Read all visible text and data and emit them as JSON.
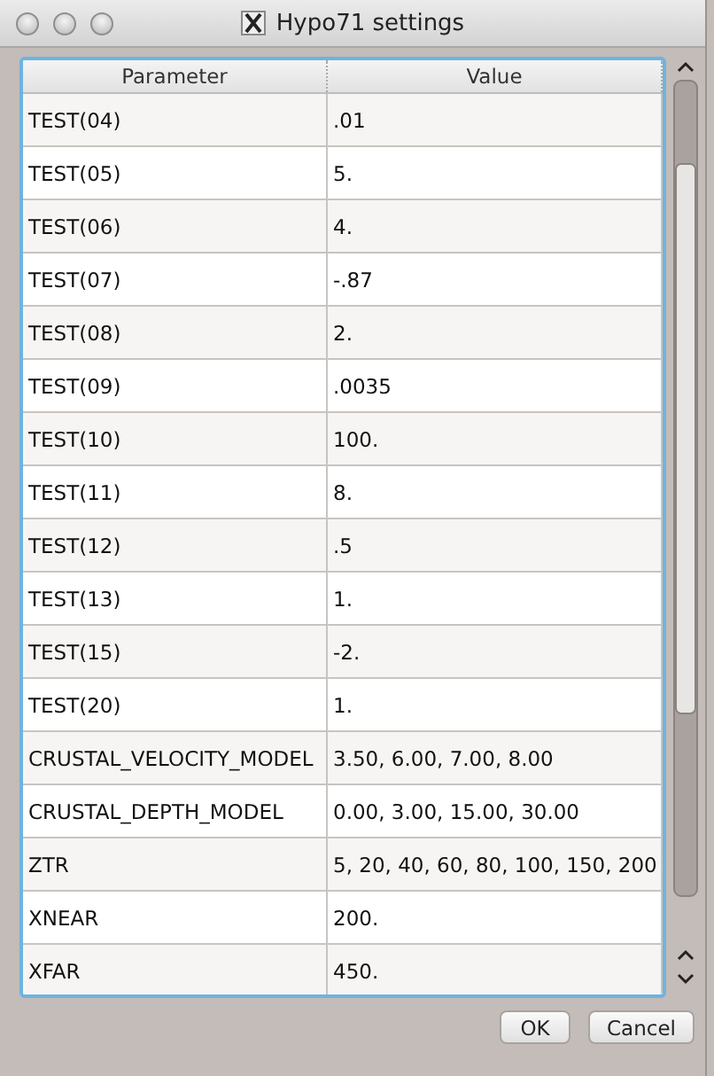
{
  "window": {
    "title": "Hypo71 settings"
  },
  "table": {
    "columns": [
      "Parameter",
      "Value"
    ],
    "rows": [
      [
        "TEST(04)",
        ".01"
      ],
      [
        "TEST(05)",
        "5."
      ],
      [
        "TEST(06)",
        "4."
      ],
      [
        "TEST(07)",
        "-.87"
      ],
      [
        "TEST(08)",
        "2."
      ],
      [
        "TEST(09)",
        ".0035"
      ],
      [
        "TEST(10)",
        "100."
      ],
      [
        "TEST(11)",
        "8."
      ],
      [
        "TEST(12)",
        ".5"
      ],
      [
        "TEST(13)",
        "1."
      ],
      [
        "TEST(15)",
        "-2."
      ],
      [
        "TEST(20)",
        "1."
      ],
      [
        "CRUSTAL_VELOCITY_MODEL",
        "3.50, 6.00, 7.00, 8.00"
      ],
      [
        "CRUSTAL_DEPTH_MODEL",
        "0.00, 3.00, 15.00, 30.00"
      ],
      [
        "ZTR",
        "5, 20, 40, 60, 80, 100, 150, 200"
      ],
      [
        "XNEAR",
        "200."
      ],
      [
        "XFAR",
        "450."
      ]
    ]
  },
  "buttons": [
    "OK",
    "Cancel"
  ]
}
